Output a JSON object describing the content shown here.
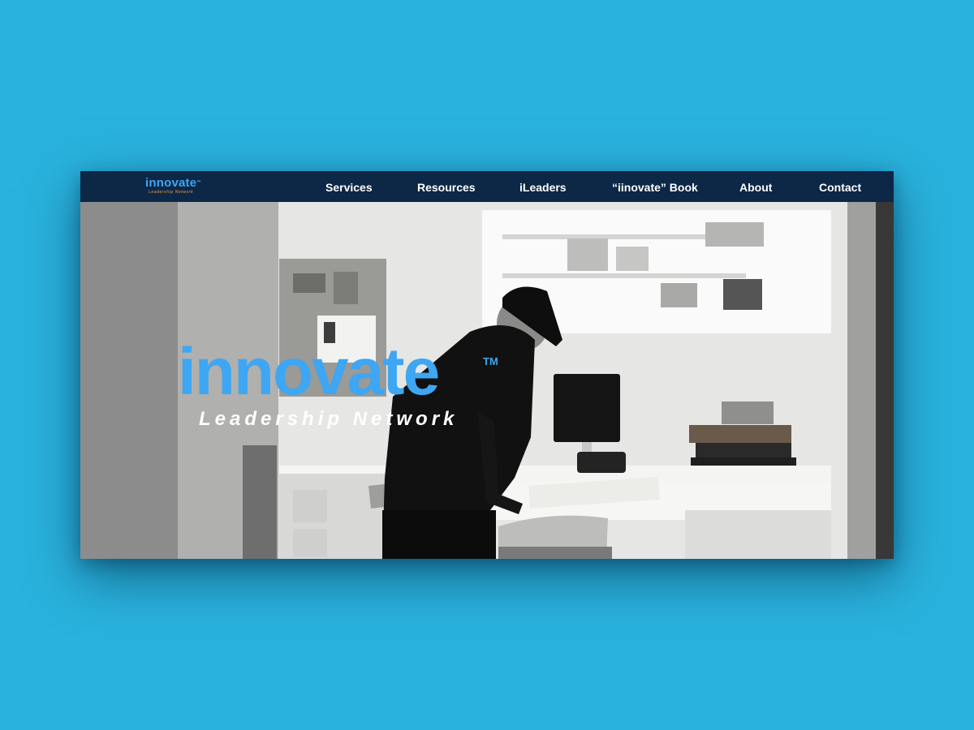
{
  "colors": {
    "page_background": "#29b2dd",
    "nav_background": "#0d2746",
    "brand_blue": "#3ea6f2",
    "brand_orange": "#e8a23a"
  },
  "nav": {
    "logo": {
      "word": "innovate",
      "tm": "™",
      "sub": "Leadership Network"
    },
    "links": [
      "Services",
      "Resources",
      "iLeaders",
      "“iinovate” Book",
      "About",
      "Contact"
    ]
  },
  "hero": {
    "title": "innovate",
    "trademark": "TM",
    "subtitle": "Leadership Network",
    "image": "black-and-white-photo-man-in-cap-working-at-desk-office"
  }
}
